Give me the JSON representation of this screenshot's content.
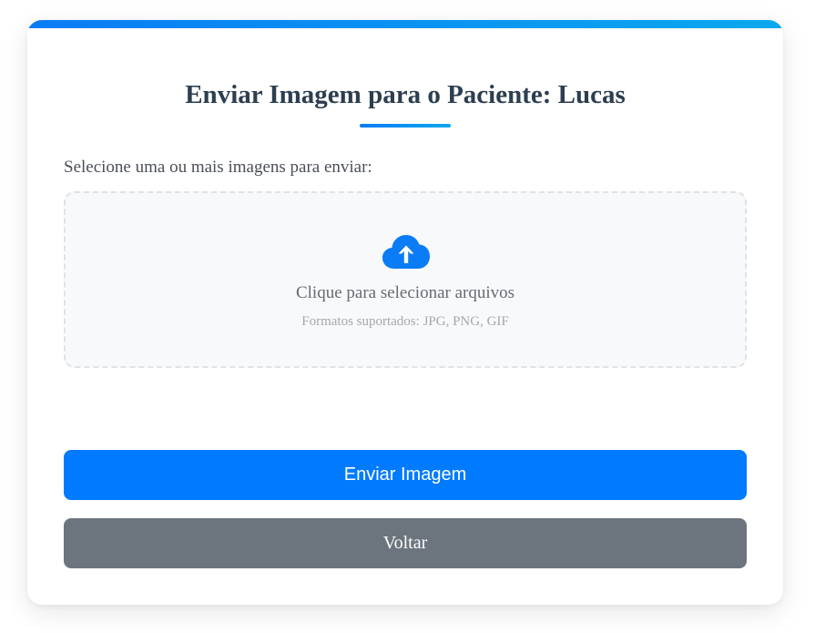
{
  "page": {
    "title": "Enviar Imagem para o Paciente: Lucas",
    "select_label": "Selecione uma ou mais imagens para enviar:"
  },
  "dropzone": {
    "icon": "cloud-upload-icon",
    "main_text": "Clique para selecionar arquivos",
    "sub_text": "Formatos suportados: JPG, PNG, GIF"
  },
  "buttons": {
    "send_label": "Enviar Imagem",
    "back_label": "Voltar"
  },
  "colors": {
    "primary": "#007bff",
    "secondary": "#6c757d",
    "title": "#2c3e50",
    "accent_gradient_start": "#0a7cf5",
    "accent_gradient_end": "#0aa8ee"
  }
}
